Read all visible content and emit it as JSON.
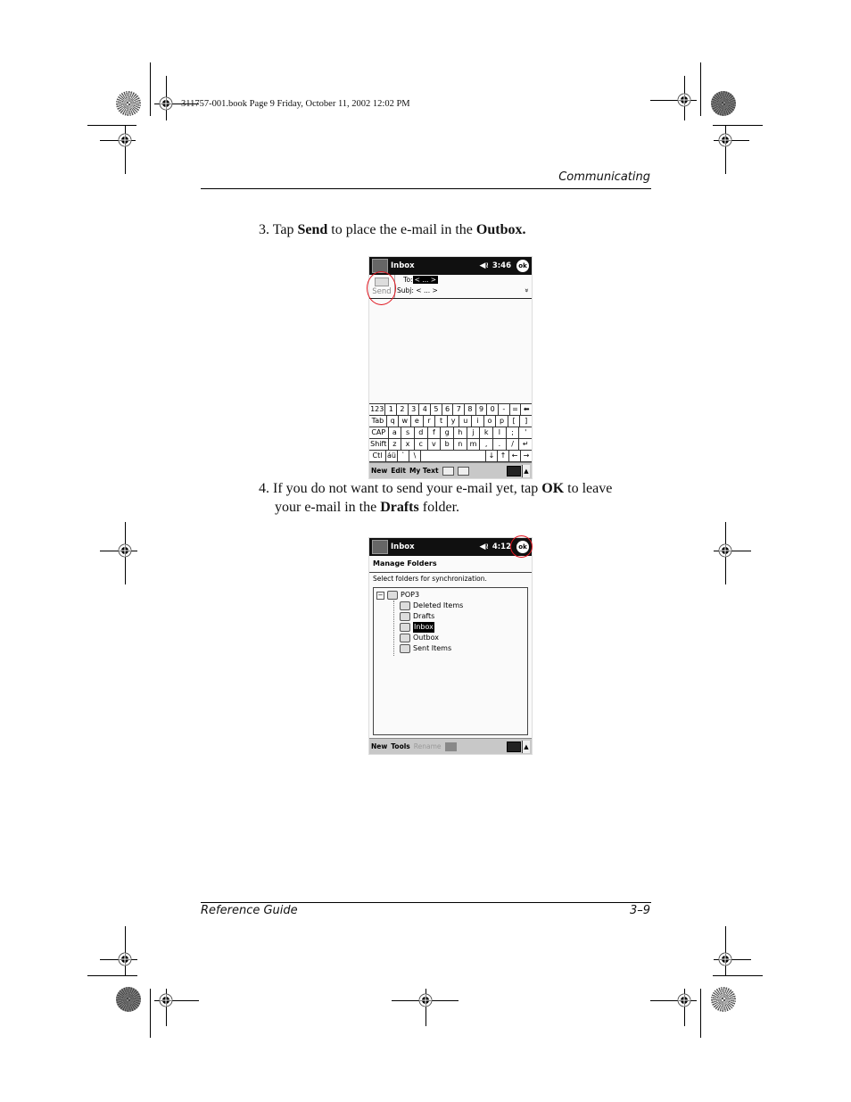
{
  "print_slug": "311757-001.book  Page 9  Friday, October 11, 2002  12:02 PM",
  "running_head": "Communicating",
  "steps": [
    {
      "number": "3.",
      "parts": [
        {
          "text": "Tap ",
          "bold": false
        },
        {
          "text": "Send",
          "bold": true
        },
        {
          "text": " to place the e-mail in the ",
          "bold": false
        },
        {
          "text": "Outbox.",
          "bold": true
        }
      ]
    },
    {
      "number": "4.",
      "line1": [
        {
          "text": "If you do not want to send your e-mail yet, tap ",
          "bold": false
        },
        {
          "text": "OK",
          "bold": true
        },
        {
          "text": " to leave",
          "bold": false
        }
      ],
      "line2": [
        {
          "text": "your e-mail in the ",
          "bold": false
        },
        {
          "text": "Drafts",
          "bold": true
        },
        {
          "text": " folder.",
          "bold": false
        }
      ]
    }
  ],
  "screen1": {
    "title": "Inbox",
    "speaker_icon": "speaker-icon",
    "time": "3:46",
    "ok_label": "ok",
    "send_label": "Send",
    "to_label": "To:",
    "to_value": "< ... >",
    "subj_label": "Subj:",
    "subj_value": "< ... >",
    "expand_glyph": "»",
    "keyboard": [
      [
        "123",
        "1",
        "2",
        "3",
        "4",
        "5",
        "6",
        "7",
        "8",
        "9",
        "0",
        "-",
        "=",
        "⬅"
      ],
      [
        "Tab",
        "q",
        "w",
        "e",
        "r",
        "t",
        "y",
        "u",
        "i",
        "o",
        "p",
        "[",
        "]"
      ],
      [
        "CAP",
        "a",
        "s",
        "d",
        "f",
        "g",
        "h",
        "j",
        "k",
        "l",
        ";",
        "'"
      ],
      [
        "Shift",
        "z",
        "x",
        "c",
        "v",
        "b",
        "n",
        "m",
        ",",
        ".",
        "/",
        "↵"
      ],
      [
        "Ctl",
        "áü",
        "`",
        "\\",
        " ",
        "↓",
        "↑",
        "←",
        "→"
      ]
    ],
    "menu": [
      "New",
      "Edit",
      "My Text"
    ],
    "up_arrow": "▲"
  },
  "screen2": {
    "title": "Inbox",
    "time": "4:12",
    "ok_label": "ok",
    "heading": "Manage Folders",
    "instruction": "Select folders for synchronization.",
    "tree_root": {
      "expander": "−",
      "label": "POP3"
    },
    "folders": [
      {
        "label": "Deleted Items",
        "selected": false
      },
      {
        "label": "Drafts",
        "selected": false
      },
      {
        "label": "Inbox",
        "selected": true
      },
      {
        "label": "Outbox",
        "selected": false
      },
      {
        "label": "Sent Items",
        "selected": false
      }
    ],
    "menu": [
      {
        "label": "New",
        "disabled": false
      },
      {
        "label": "Tools",
        "disabled": false
      },
      {
        "label": "Rename",
        "disabled": true
      }
    ],
    "up_arrow": "▲"
  },
  "annotation_color": "#e0141e",
  "footer": {
    "left": "Reference Guide",
    "right": "3–9"
  }
}
